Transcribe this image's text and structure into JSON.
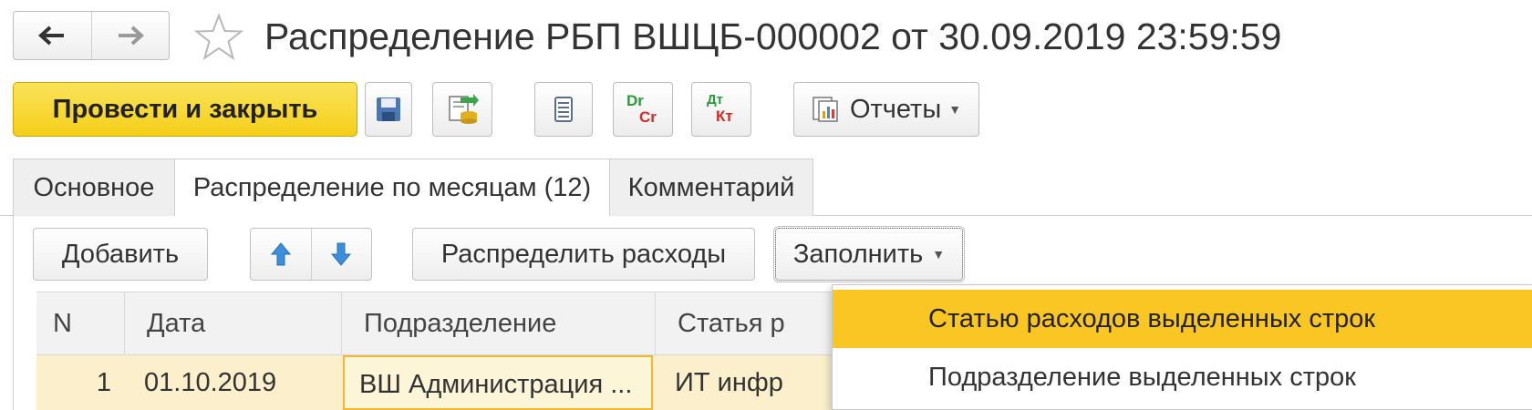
{
  "window": {
    "title": "Распределение РБП ВШЦБ-000002 от 30.09.2019 23:59:59",
    "back_icon": "arrow-left-icon",
    "forward_icon": "arrow-right-icon",
    "favorite_icon": "star-icon"
  },
  "toolbar": {
    "post_close_label": "Провести и закрыть",
    "save_icon": "floppy-disk-icon",
    "post_icon": "post-document-icon",
    "list_icon": "list-icon",
    "dr_cr": {
      "top": "Dr",
      "bottom": "Cr"
    },
    "dt_kt": {
      "top": "Дт",
      "bottom": "Кт"
    },
    "reports_label": "Отчеты",
    "accent_color": "#f4cf18"
  },
  "tabs": [
    {
      "label": "Основное",
      "active": false
    },
    {
      "label": "Распределение по месяцам (12)",
      "active": true
    },
    {
      "label": "Комментарий",
      "active": false
    }
  ],
  "form_toolbar": {
    "add_label": "Добавить",
    "move_up_icon": "arrow-up-icon",
    "move_down_icon": "arrow-down-icon",
    "distribute_label": "Распределить расходы",
    "fill_label": "Заполнить"
  },
  "table": {
    "columns": [
      "N",
      "Дата",
      "Подразделение",
      "Статья р"
    ],
    "rows": [
      {
        "n": "1",
        "date": "01.10.2019",
        "division": "ВШ Администрация ...",
        "article": "ИТ инфр"
      }
    ]
  },
  "fill_menu": {
    "items": [
      {
        "label": "Статью расходов выделенных строк",
        "highlighted": true
      },
      {
        "label": "Подразделение выделенных строк",
        "highlighted": false
      }
    ],
    "highlight_color": "#f9c623"
  }
}
